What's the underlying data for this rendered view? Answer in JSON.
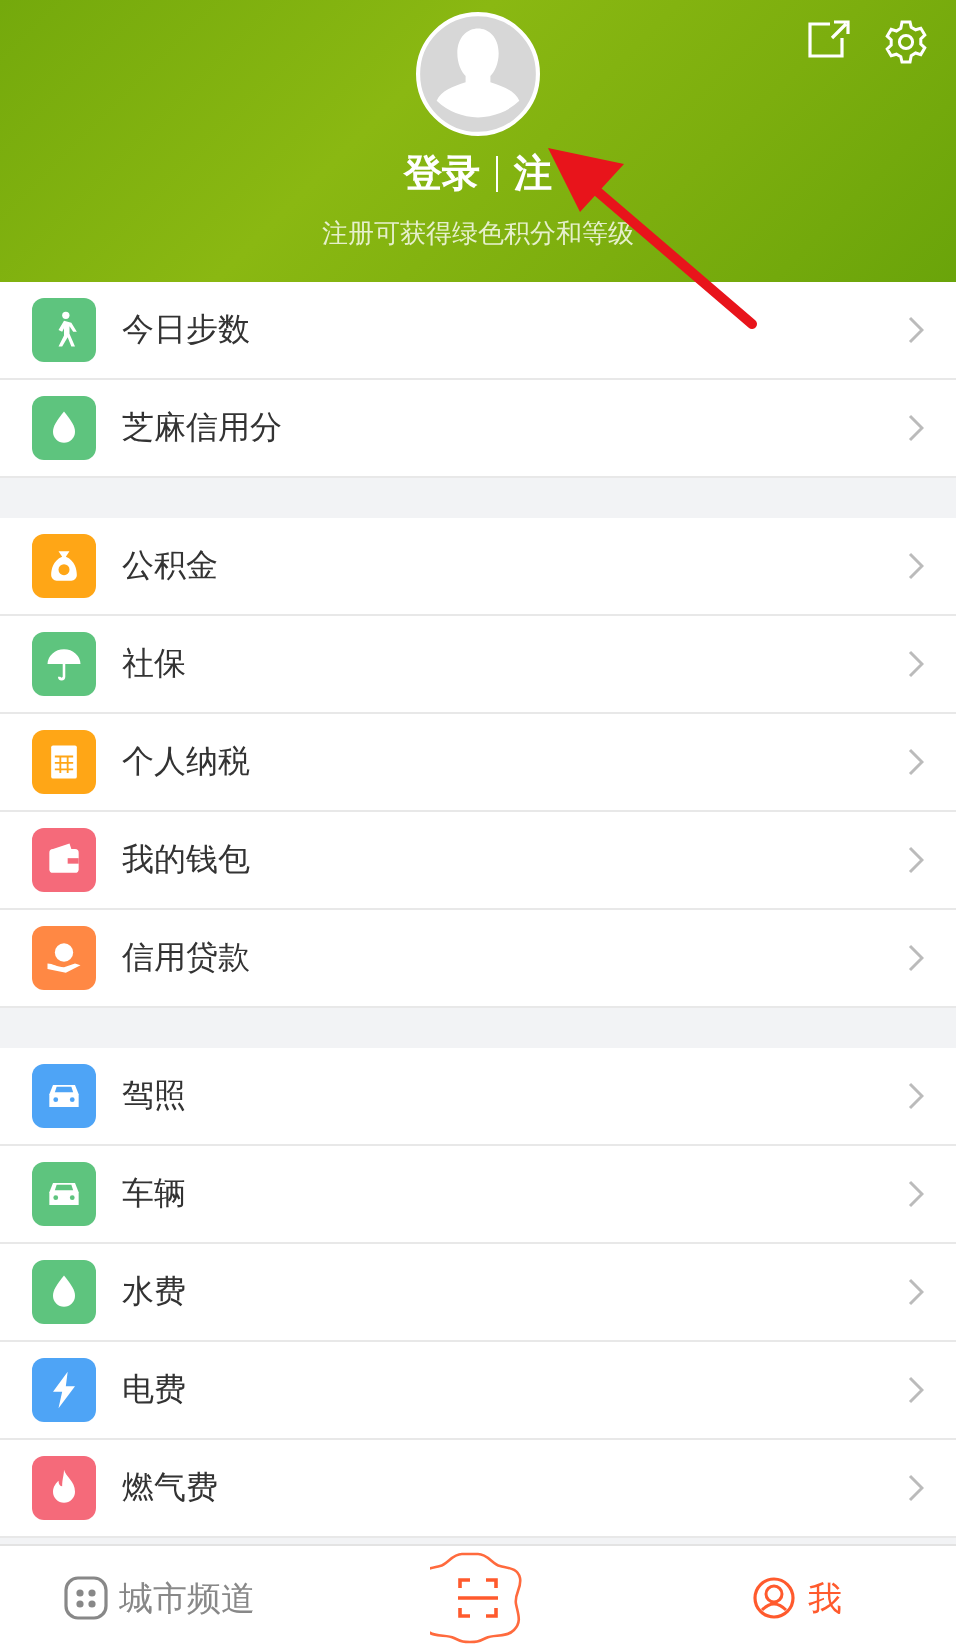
{
  "header": {
    "login": "登录",
    "register": "注",
    "subtitle": "注册可获得绿色积分和等级"
  },
  "groups": [
    [
      {
        "kind": "walk",
        "label": "今日步数",
        "color": "#5ec47e"
      },
      {
        "kind": "drop",
        "label": "芝麻信用分",
        "color": "#5ec47e"
      }
    ],
    [
      {
        "kind": "bag",
        "label": "公积金",
        "color": "#ffa616"
      },
      {
        "kind": "umbrella",
        "label": "社保",
        "color": "#5ec47e"
      },
      {
        "kind": "calc",
        "label": "个人纳税",
        "color": "#ffa616"
      },
      {
        "kind": "wallet",
        "label": "我的钱包",
        "color": "#f56a7a"
      },
      {
        "kind": "loan",
        "label": "信用贷款",
        "color": "#ff8844"
      }
    ],
    [
      {
        "kind": "car",
        "label": "驾照",
        "color": "#4ea4f6"
      },
      {
        "kind": "vehicle",
        "label": "车辆",
        "color": "#5ec47e"
      },
      {
        "kind": "drop",
        "label": "水费",
        "color": "#5ec47e"
      },
      {
        "kind": "bolt",
        "label": "电费",
        "color": "#4ea4f6"
      },
      {
        "kind": "flame",
        "label": "燃气费",
        "color": "#f56a7a"
      }
    ]
  ],
  "tabbar": [
    {
      "kind": "channel",
      "label": "城市频道",
      "selected": false
    },
    {
      "kind": "scan"
    },
    {
      "kind": "me",
      "label": "我",
      "selected": true
    }
  ]
}
